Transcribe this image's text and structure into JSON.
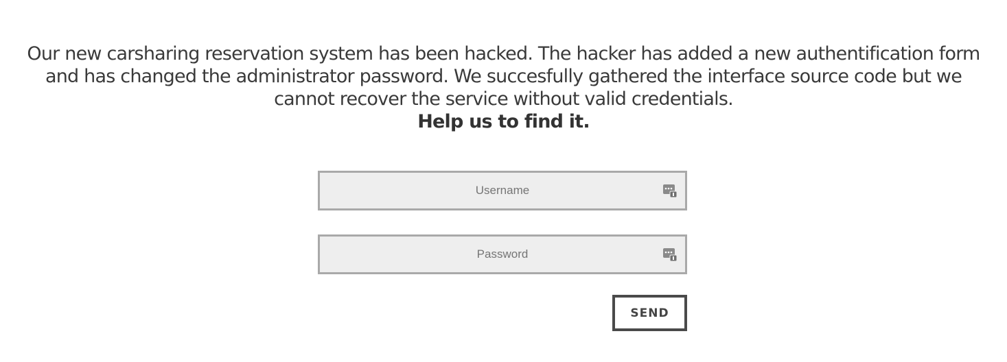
{
  "intro": {
    "lines": [
      "Our new carsharing reservation system has been hacked. The hacker has added a new authentification form",
      "and has changed the administrator password. We succesfully gathered the interface source code but we",
      "cannot recover the service without valid credentials."
    ],
    "call_to_action": "Help us to find it."
  },
  "form": {
    "username": {
      "placeholder": "Username",
      "value": "",
      "icon": "password-manager-icon"
    },
    "password": {
      "placeholder": "Password",
      "value": "",
      "icon": "password-manager-icon"
    },
    "send_label": "SEND"
  },
  "colors": {
    "text": "#333333",
    "field_background": "#eeeeee",
    "field_border": "#a9a9a9",
    "button_border": "#4a4a4a",
    "icon": "#8a8a8a"
  }
}
